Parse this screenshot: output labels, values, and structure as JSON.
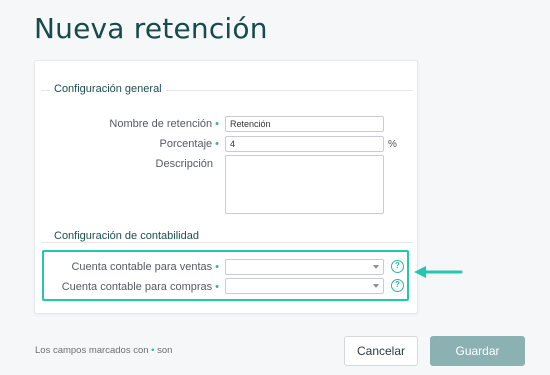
{
  "page": {
    "title": "Nueva retención"
  },
  "general": {
    "section_title": "Configuración general",
    "nombre_label": "Nombre de retención",
    "nombre_value": "Retención",
    "porcentaje_label": "Porcentaje",
    "porcentaje_value": "4",
    "porcentaje_unit": "%",
    "descripcion_label": "Descripción"
  },
  "accounting": {
    "section_title": "Configuración de contabilidad",
    "ventas_label": "Cuenta contable para ventas",
    "compras_label": "Cuenta contable para compras",
    "help_glyph": "?"
  },
  "required_marker": "•",
  "footer": {
    "note_prefix": "Los campos marcados con",
    "note_marker": "•",
    "note_suffix": "son"
  },
  "buttons": {
    "cancel": "Cancelar",
    "save": "Guardar"
  },
  "colors": {
    "accent": "#2bb7a3",
    "highlight": "#22c7ad",
    "title": "#174a4c",
    "save_button": "#8bb1b3"
  },
  "icons": [
    "help-icon",
    "chevron-down-icon",
    "arrow-left-icon"
  ]
}
